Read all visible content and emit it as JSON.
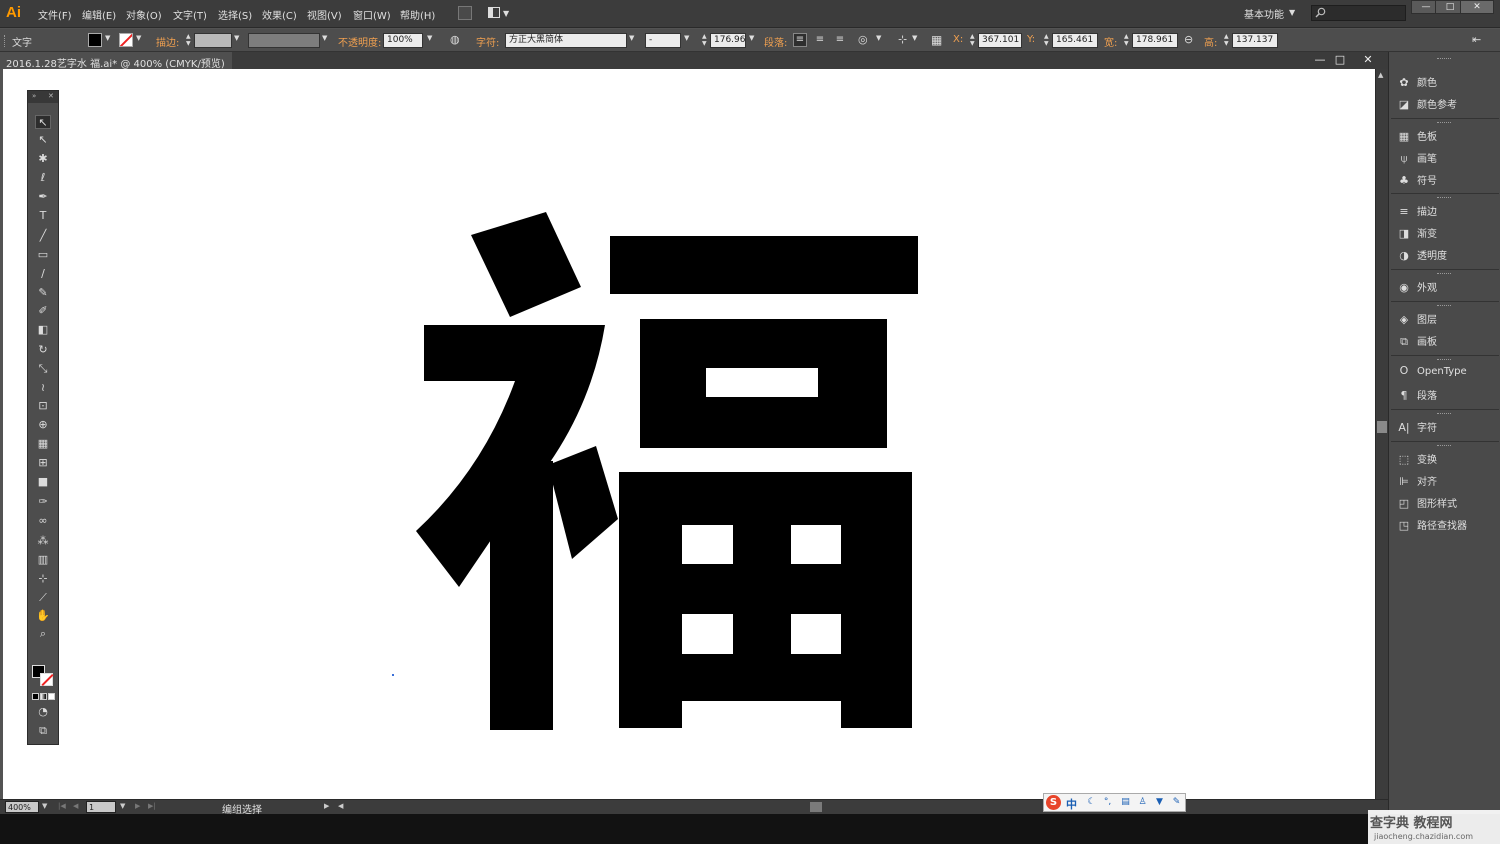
{
  "app": {
    "logo": "Ai"
  },
  "menu": [
    {
      "label": "文件(F)"
    },
    {
      "label": "编辑(E)"
    },
    {
      "label": "对象(O)"
    },
    {
      "label": "文字(T)"
    },
    {
      "label": "选择(S)"
    },
    {
      "label": "效果(C)"
    },
    {
      "label": "视图(V)"
    },
    {
      "label": "窗口(W)"
    },
    {
      "label": "帮助(H)"
    }
  ],
  "workspace": {
    "label": "基本功能"
  },
  "window_buttons": {
    "minimize": "—",
    "maximize": "□",
    "close": "✕"
  },
  "control": {
    "tool_label": "文字",
    "stroke_label": "描边:",
    "opacity_label": "不透明度:",
    "opacity_value": "100%",
    "font_label": "字符:",
    "font_name": "方正大黑简体",
    "font_style": "-",
    "font_size": "176.96",
    "paragraph_label": "段落:",
    "x_label": "X:",
    "x_value": "367.101",
    "y_label": "Y:",
    "y_value": "165.461",
    "w_label": "宽:",
    "w_value": "178.961",
    "h_label": "高:",
    "h_value": "137.137"
  },
  "document": {
    "title": "2016.1.28艺字水 福.ai* @ 400% (CMYK/预览)",
    "glyph": "福"
  },
  "tools": [
    {
      "name": "selection-tool",
      "glyph": "↖"
    },
    {
      "name": "direct-selection-tool",
      "glyph": "↖"
    },
    {
      "name": "magic-wand-tool",
      "glyph": "✱"
    },
    {
      "name": "lasso-tool",
      "glyph": "ℓ"
    },
    {
      "name": "pen-tool",
      "glyph": "✒"
    },
    {
      "name": "type-tool",
      "glyph": "T"
    },
    {
      "name": "line-tool",
      "glyph": "╱"
    },
    {
      "name": "rectangle-tool",
      "glyph": "▭"
    },
    {
      "name": "paintbrush-tool",
      "glyph": "∕"
    },
    {
      "name": "pencil-tool",
      "glyph": "✎"
    },
    {
      "name": "blob-brush-tool",
      "glyph": "✐"
    },
    {
      "name": "eraser-tool",
      "glyph": "◧"
    },
    {
      "name": "rotate-tool",
      "glyph": "↻"
    },
    {
      "name": "scale-tool",
      "glyph": "⤡"
    },
    {
      "name": "width-tool",
      "glyph": "≀"
    },
    {
      "name": "free-transform-tool",
      "glyph": "⊡"
    },
    {
      "name": "shape-builder-tool",
      "glyph": "⊕"
    },
    {
      "name": "perspective-grid-tool",
      "glyph": "▦"
    },
    {
      "name": "mesh-tool",
      "glyph": "⊞"
    },
    {
      "name": "gradient-tool",
      "glyph": "■"
    },
    {
      "name": "eyedropper-tool",
      "glyph": "✑"
    },
    {
      "name": "blend-tool",
      "glyph": "∞"
    },
    {
      "name": "symbol-sprayer-tool",
      "glyph": "⁂"
    },
    {
      "name": "column-graph-tool",
      "glyph": "▥"
    },
    {
      "name": "artboard-tool",
      "glyph": "⊹"
    },
    {
      "name": "slice-tool",
      "glyph": "⟋"
    },
    {
      "name": "hand-tool",
      "glyph": "✋"
    },
    {
      "name": "zoom-tool",
      "glyph": "⌕"
    }
  ],
  "right_panel": [
    {
      "name": "panel-color",
      "icon": "✿",
      "label": "颜色"
    },
    {
      "name": "panel-color-guide",
      "icon": "◪",
      "label": "颜色参考"
    },
    {
      "name": "panel-swatches",
      "icon": "▦",
      "label": "色板"
    },
    {
      "name": "panel-brushes",
      "icon": "⍦",
      "label": "画笔"
    },
    {
      "name": "panel-symbols",
      "icon": "♣",
      "label": "符号"
    },
    {
      "name": "panel-stroke",
      "icon": "≡",
      "label": "描边"
    },
    {
      "name": "panel-gradient",
      "icon": "◨",
      "label": "渐变"
    },
    {
      "name": "panel-transparency",
      "icon": "◑",
      "label": "透明度"
    },
    {
      "name": "panel-appearance",
      "icon": "◉",
      "label": "外观"
    },
    {
      "name": "panel-layers",
      "icon": "◈",
      "label": "图层"
    },
    {
      "name": "panel-artboards",
      "icon": "⧉",
      "label": "画板"
    },
    {
      "name": "panel-opentype",
      "icon": "O",
      "label": "OpenType"
    },
    {
      "name": "panel-paragraph",
      "icon": "¶",
      "label": "段落"
    },
    {
      "name": "panel-character",
      "icon": "A|",
      "label": "字符"
    },
    {
      "name": "panel-transform",
      "icon": "⬚",
      "label": "变换"
    },
    {
      "name": "panel-align",
      "icon": "⊫",
      "label": "对齐"
    },
    {
      "name": "panel-graphic-styles",
      "icon": "◰",
      "label": "图形样式"
    },
    {
      "name": "panel-pathfinder",
      "icon": "◳",
      "label": "路径查找器"
    }
  ],
  "status": {
    "zoom": "400%",
    "page": "1",
    "text": "编组选择"
  },
  "ime": {
    "logo": "S",
    "lang": "中"
  },
  "watermark": {
    "main": "查字典 教程网",
    "sub": "jiaocheng.chazidian.com"
  },
  "colors": {
    "accent": "#ff9a00",
    "fill": "#000000",
    "stroke_none": "#ee2222",
    "canvas": "#ffffff"
  }
}
